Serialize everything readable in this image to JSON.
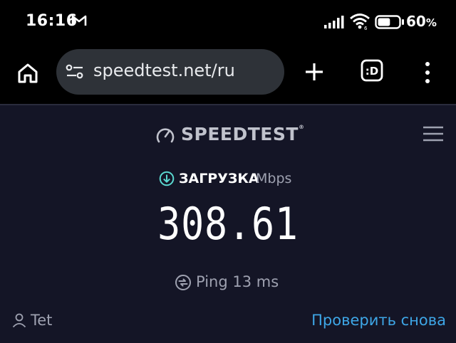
{
  "status_bar": {
    "time": "16:16",
    "battery_percent": "60",
    "battery_unit": "%",
    "battery_level": 0.6,
    "icons": [
      "gmail-icon",
      "signal-icon",
      "wifi-icon",
      "battery-icon"
    ]
  },
  "browser": {
    "url": "speedtest.net/ru",
    "icons": [
      "home-icon",
      "site-settings-icon",
      "new-tab-icon",
      "tab-switcher-icon",
      "menu-icon"
    ]
  },
  "speedtest": {
    "logo_text": "SPEEDTEST",
    "download_label": "ЗАГРУЗКА",
    "unit": "Mbps",
    "download_value": "308.61",
    "ping_label": "Ping 13 ms",
    "user_label": "Tet",
    "retest_label": "Проверить снова"
  },
  "colors": {
    "page_background": "#141526",
    "accent_cyan": "#5ad8d0",
    "link_blue": "#3ea6e6",
    "muted_text": "#9ea1b0"
  }
}
